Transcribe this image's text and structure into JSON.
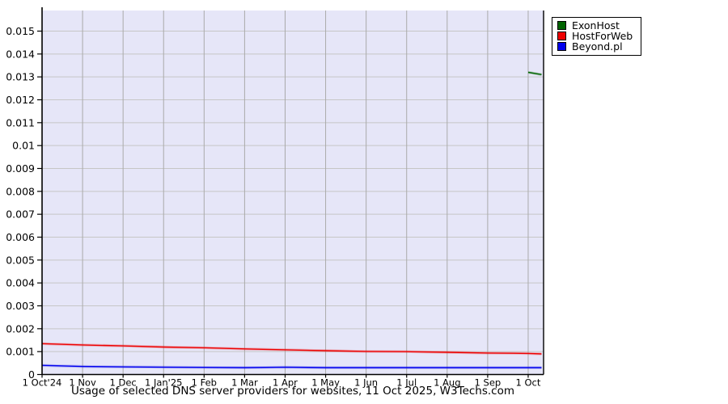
{
  "chart_data": {
    "type": "line",
    "title": "Usage of selected DNS server providers for websites, 11 Oct 2025, W3Techs.com",
    "plot_bg": "#e6e6f8",
    "axis_color": "#000000",
    "h_grid_color": "#c6c6c6",
    "v_grid_color": "#aaaaaa",
    "grid": true,
    "legend_position": "top-right-outside",
    "xlim": [
      0,
      12.38
    ],
    "ylim": [
      0,
      0.0159
    ],
    "x_tick_positions": [
      0,
      1,
      2,
      3,
      4,
      5,
      6,
      7,
      8,
      9,
      10,
      11,
      12
    ],
    "x_tick_labels": [
      "1 Oct'24",
      "1 Nov",
      "1 Dec",
      "1 Jan'25",
      "1 Feb",
      "1 Mar",
      "1 Apr",
      "1 May",
      "1 Jun",
      "1 Jul",
      "1 Aug",
      "1 Sep",
      "1 Oct"
    ],
    "y_tick_values": [
      0.015,
      0.014,
      0.013,
      0.012,
      0.011,
      0.01,
      0.009,
      0.008,
      0.007,
      0.006,
      0.005,
      0.004,
      0.003,
      0.002,
      0.001,
      0
    ],
    "y_tick_labels": [
      "0.015",
      "0.014",
      "0.013",
      "0.012",
      "0.011",
      "0.01",
      "0.009",
      "0.008",
      "0.007",
      "0.006",
      "0.005",
      "0.004",
      "0.003",
      "0.002",
      "0.001",
      "0"
    ],
    "series": [
      {
        "name": "ExonHost",
        "color": "#006400",
        "x": [
          12,
          12.33
        ],
        "values": [
          0.0132,
          0.0131
        ]
      },
      {
        "name": "HostForWeb",
        "color": "#ee0000",
        "x": [
          0,
          1,
          2,
          3,
          4,
          5,
          6,
          7,
          8,
          9,
          10,
          11,
          12,
          12.33
        ],
        "values": [
          0.00135,
          0.00129,
          0.00125,
          0.0012,
          0.00117,
          0.00112,
          0.00108,
          0.00104,
          0.00101,
          0.001,
          0.00097,
          0.00094,
          0.00092,
          0.0009
        ]
      },
      {
        "name": "Beyond.pl",
        "color": "#0000ee",
        "x": [
          0,
          1,
          2,
          3,
          4,
          5,
          6,
          7,
          8,
          9,
          10,
          11,
          12,
          12.33
        ],
        "values": [
          0.0004,
          0.00035,
          0.00033,
          0.00032,
          0.00031,
          0.0003,
          0.00032,
          0.0003,
          0.0003,
          0.0003,
          0.0003,
          0.0003,
          0.0003,
          0.0003
        ]
      }
    ]
  }
}
